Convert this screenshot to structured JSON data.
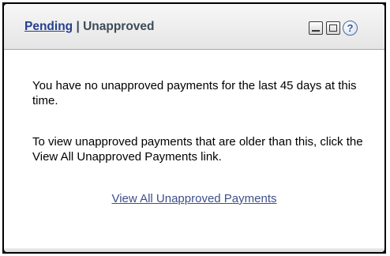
{
  "widget": {
    "title_link": "Pending",
    "title_separator": " | ",
    "title_current": "Unapproved",
    "tools": {
      "minimize_icon": "minimize-icon",
      "maximize_icon": "maximize-icon",
      "help_icon": "help-icon",
      "help_glyph": "?"
    }
  },
  "content": {
    "message": "You have no unapproved payments for the last 45 days at this time.",
    "instruction": "To view unapproved payments that are older than this, click the View All Unapproved Payments link.",
    "link_text": "View All Unapproved Payments"
  },
  "colors": {
    "link": "#26408f",
    "title_text": "#3d4a57",
    "header_bg": "#ececec"
  }
}
